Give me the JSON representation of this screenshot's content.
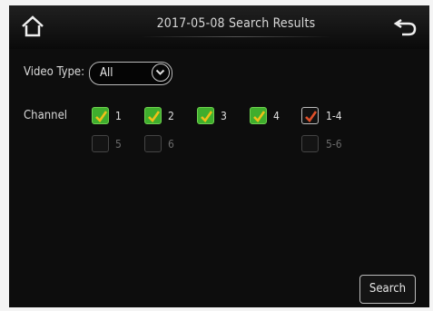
{
  "header": {
    "title": "2017-05-08 Search Results"
  },
  "video_type": {
    "label": "Video Type:",
    "value": "All"
  },
  "channel": {
    "label": "Channel",
    "items": [
      {
        "label": "1",
        "checked": true
      },
      {
        "label": "2",
        "checked": true
      },
      {
        "label": "3",
        "checked": true
      },
      {
        "label": "4",
        "checked": true
      },
      {
        "label": "1-4",
        "checked": true
      },
      {
        "label": "5",
        "checked": false
      },
      {
        "label": "6",
        "checked": false
      },
      {
        "label": "5-6",
        "checked": false
      }
    ]
  },
  "search_button": {
    "label": "Search"
  },
  "icons": {
    "home": "home-icon",
    "back": "back-arrow-icon",
    "dropdown": "chevron-down-icon"
  },
  "colors": {
    "checked": "#3fae2d",
    "group_check": "#e0502a",
    "background": "#0d0d0d"
  }
}
